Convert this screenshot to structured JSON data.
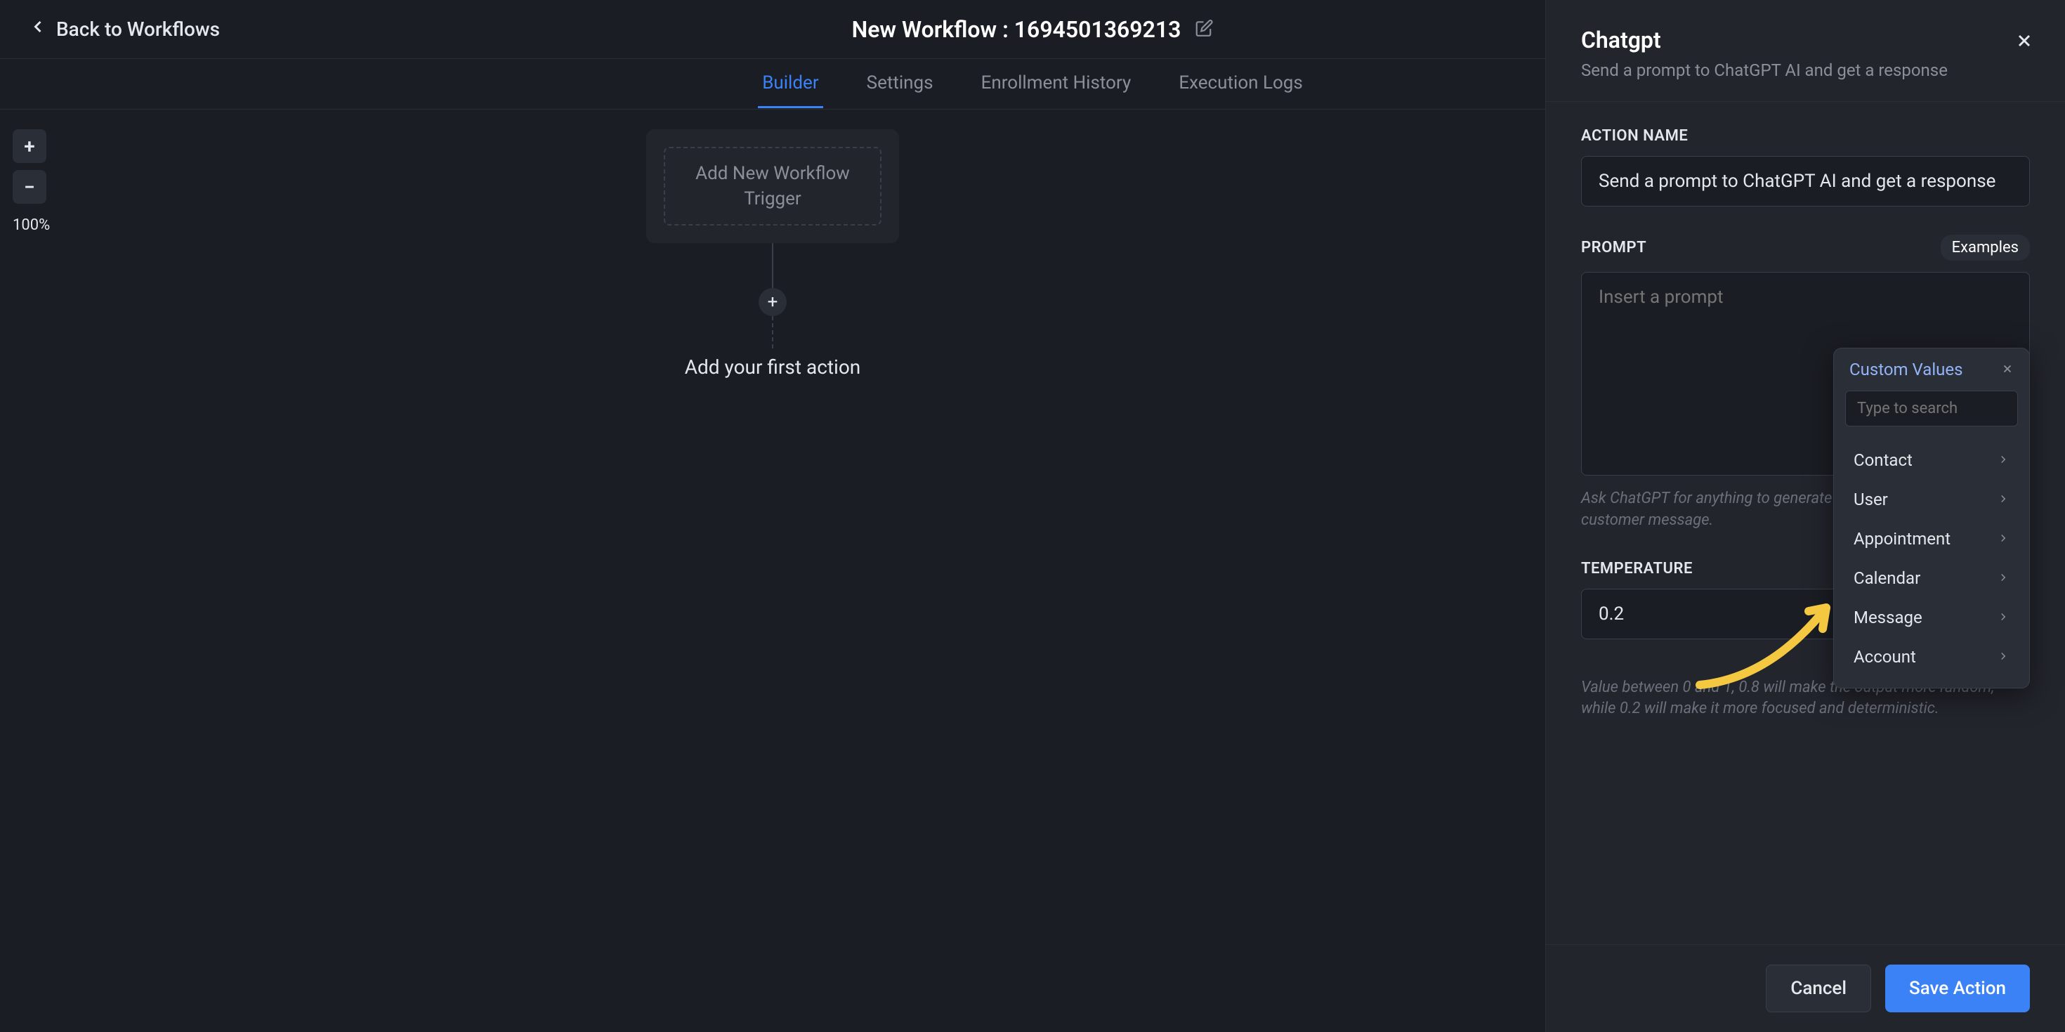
{
  "header": {
    "back_label": "Back to Workflows",
    "title": "New Workflow : 1694501369213"
  },
  "tabs": {
    "builder": "Builder",
    "settings": "Settings",
    "enrollment": "Enrollment History",
    "execution": "Execution Logs"
  },
  "canvas": {
    "zoom_level": "100%",
    "trigger_line1": "Add New Workflow",
    "trigger_line2": "Trigger",
    "add_action_text": "Add your first action"
  },
  "panel": {
    "title": "Chatgpt",
    "subtitle": "Send a prompt to ChatGPT AI and get a response",
    "action_name_label": "ACTION NAME",
    "action_name_value": "Send a prompt to ChatGPT AI and get a response",
    "prompt_label": "PROMPT",
    "examples_link": "Examples",
    "prompt_placeholder": "Insert a prompt",
    "prompt_helper": "Ask ChatGPT for anything to generate completion response for customer message.",
    "temperature_label": "TEMPERATURE",
    "temperature_value": "0.2",
    "temperature_helper": "Value between 0 and 1, 0.8 will make the output more random, while 0.2 will make it more focused and deterministic.",
    "cancel_label": "Cancel",
    "save_label": "Save Action"
  },
  "dropdown": {
    "header_label": "Custom Values",
    "search_placeholder": "Type to search",
    "items": {
      "contact": "Contact",
      "user": "User",
      "appointment": "Appointment",
      "calendar": "Calendar",
      "message": "Message",
      "account": "Account"
    }
  }
}
